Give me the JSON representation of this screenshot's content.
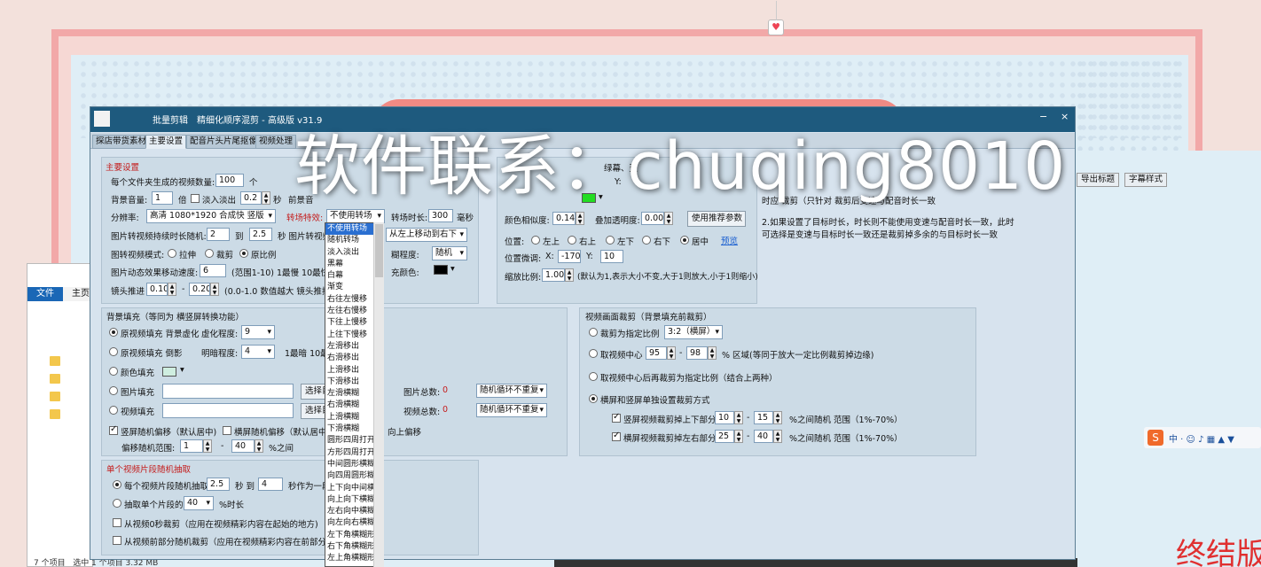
{
  "watermark": "软件联系：chuqing8010",
  "pin_icon": "♥",
  "explorer": {
    "file_tab": "文件",
    "home_tab": "主页",
    "status_items": "7 个项目",
    "status_selected": "选中 1 个项目  3.32 MB"
  },
  "app": {
    "title_app": "批量剪辑",
    "title_sub": "精细化顺序混剪 - 高级版  v31.9",
    "minimize": "−",
    "close": "×",
    "tabs": [
      "探店带货素材",
      "主要设置",
      "配音片头片尾抠像",
      "视频处理"
    ],
    "main": {
      "title": "主要设置",
      "videos_per_folder_label": "每个文件夹生成的视频数量:",
      "videos_per_folder": "100",
      "videos_per_folder_unit": "个",
      "bg_volume_label": "背景音量:",
      "bg_volume": "1",
      "bg_volume_unit": "倍",
      "fade_label": "淡入淡出",
      "fade_value": "0.2",
      "fade_unit": "秒",
      "front_bg_label": "前景音",
      "resolution_label": "分辨率:",
      "resolution": "高清 1080*1920 合成快 竖版",
      "transition_label": "转场特效:",
      "transition_value": "不使用转场",
      "transition_dur_label": "转场时长:",
      "transition_dur": "300",
      "transition_dur_unit": "毫秒",
      "img_dur_label": "图片转视频持续时长随机:",
      "img_dur_min": "2",
      "img_dur_to": "到",
      "img_dur_max": "2.5",
      "img_dur_unit": "秒  图片转视频",
      "move_dir": "从左上移动到右下",
      "img_mode_label": "图转视频模式:",
      "mode_stretch": "拉伸",
      "mode_crop": "裁剪",
      "mode_ratio": "原比例",
      "blur_degree_label": "糊程度:",
      "blur_degree": "随机",
      "speed_label": "图片动态效果移动速度:",
      "speed_value": "6",
      "speed_note": "(范围1-10) 1最慢 10最快",
      "fill_color_label": "充颜色:",
      "lens_label": "镜头推进",
      "lens_min": "0.10",
      "lens_max": "0.20",
      "lens_note": "(0.0-1.0 数值越大 镜头推拉"
    },
    "color_panel": {
      "color_similarity_label": "颜色相似度:",
      "color_similarity": "0.14",
      "overlay_alpha_label": "叠加透明度:",
      "overlay_alpha": "0.00",
      "use_recommended": "使用推荐参数",
      "position_label": "位置:",
      "positions": [
        "左上",
        "右上",
        "左下",
        "右下",
        "居中"
      ],
      "preview_link": "预览",
      "pos_adjust_label": "位置微调:",
      "pos_x_label": "X:",
      "pos_x": "-170",
      "pos_y_label": "Y:",
      "pos_y": "10",
      "scale_label": "缩放比例:",
      "scale": "1.00",
      "scale_note": "(默认为1,表示大小不变,大于1则放大,小于1则缩小)",
      "y_label": "Y:",
      "partial_label": "绿幕、蓝"
    },
    "info": {
      "line1": "时应      裁剪（只针对      裁剪后变速与配音时长一致",
      "line2": "2.如果设置了目标时长，时长则不能使用变速与配音时长一致，此时",
      "line3": "可选择是变速与目标时长一致还是裁剪掉多余的与目标时长一致"
    },
    "bg_fill": {
      "title": "背景填充（等同为 横竖屏转换功能）",
      "orig_fill_label": "原视频填充 背景虚化",
      "blur_label": "虚化程度:",
      "blur_value": "9",
      "orig_fill_shadow_label": "原视频填充 倒影",
      "brightness_label": "明暗程度:",
      "brightness_value": "4",
      "brightness_note": "1最暗 10最亮",
      "color_fill_label": "颜色填充",
      "image_fill_label": "图片填充",
      "select_dir": "选择目",
      "img_total_label": "图片总数:",
      "img_total": "0",
      "img_loop": "随机循环不重复",
      "video_fill_label": "视频填充",
      "video_total_label": "视频总数:",
      "video_total": "0",
      "video_loop": "随机循环不重复",
      "vert_offset_label": "竖屏随机偏移（默认居中)",
      "horiz_offset_label": "横屏随机偏移（默认居中)",
      "dir_label": "向上偏移",
      "offset_range_label": "偏移随机范围:",
      "offset_min": "1",
      "offset_max": "40",
      "offset_unit": "%之间"
    },
    "crop": {
      "title": "视频画面裁剪（背景填充前裁剪）",
      "crop_ratio_label": "裁剪为指定比例",
      "crop_ratio": "3:2（横屏）",
      "center_label": "取视频中心",
      "center_min": "95",
      "center_max": "98",
      "center_note": "% 区域(等同于放大一定比例裁剪掉边缘)",
      "center_crop_label": "取视频中心后再裁剪为指定比例（结合上两种）",
      "separate_label": "横屏和竖屏单独设置裁剪方式",
      "vert_crop_label": "竖屏视频裁剪掉上下部分",
      "vert_min": "10",
      "vert_max": "15",
      "vert_note": "%之间随机 范围（1%-70%）",
      "horiz_crop_label": "横屏视频裁剪掉左右部分",
      "horiz_min": "25",
      "horiz_max": "40",
      "horiz_note": "%之间随机 范围（1%-70%）"
    },
    "segment": {
      "title": "单个视频片段随机抽取",
      "each_label": "每个视频片段随机抽取",
      "each_min": "2.5",
      "each_to_label": "秒 到",
      "each_max": "4",
      "each_unit": "秒作为一段",
      "single_label": "抽取单个片段的",
      "single_value": "40",
      "single_unit": "%时长",
      "from_start_label": "从视频0秒裁剪（应用在视频精彩内容在起始的地方)",
      "from_front_label": "从视频前部分随机裁剪（应用在视频精彩内容在前部分的地"
    }
  },
  "dropdown_items": [
    "不使用转场",
    "随机转场",
    "淡入淡出",
    "黑幕",
    "白幕",
    "渐变",
    "右往左慢移",
    "左往右慢移",
    "下往上慢移",
    "上往下慢移",
    "左滑移出",
    "右滑移出",
    "上滑移出",
    "下滑移出",
    "左滑横糊",
    "右滑横糊",
    "上滑横糊",
    "下滑横糊",
    "圆形四周打开",
    "方形四周打开",
    "中间圆形横糊",
    "向四周圆形糊",
    "上下向中间横",
    "向上向下横糊",
    "左右向中横糊",
    "向左向右横糊",
    "左下角横糊形",
    "右下角横糊形",
    "左上角横糊形"
  ],
  "right_tabs": [
    "导出标题",
    "字幕样式"
  ],
  "end_text": "终结版",
  "colors": {
    "title_bar": "#1e5a7e",
    "accent_red": "#c41c1c",
    "frame_pink": "#f2a8a8",
    "green_swatch": "#22dd22"
  }
}
